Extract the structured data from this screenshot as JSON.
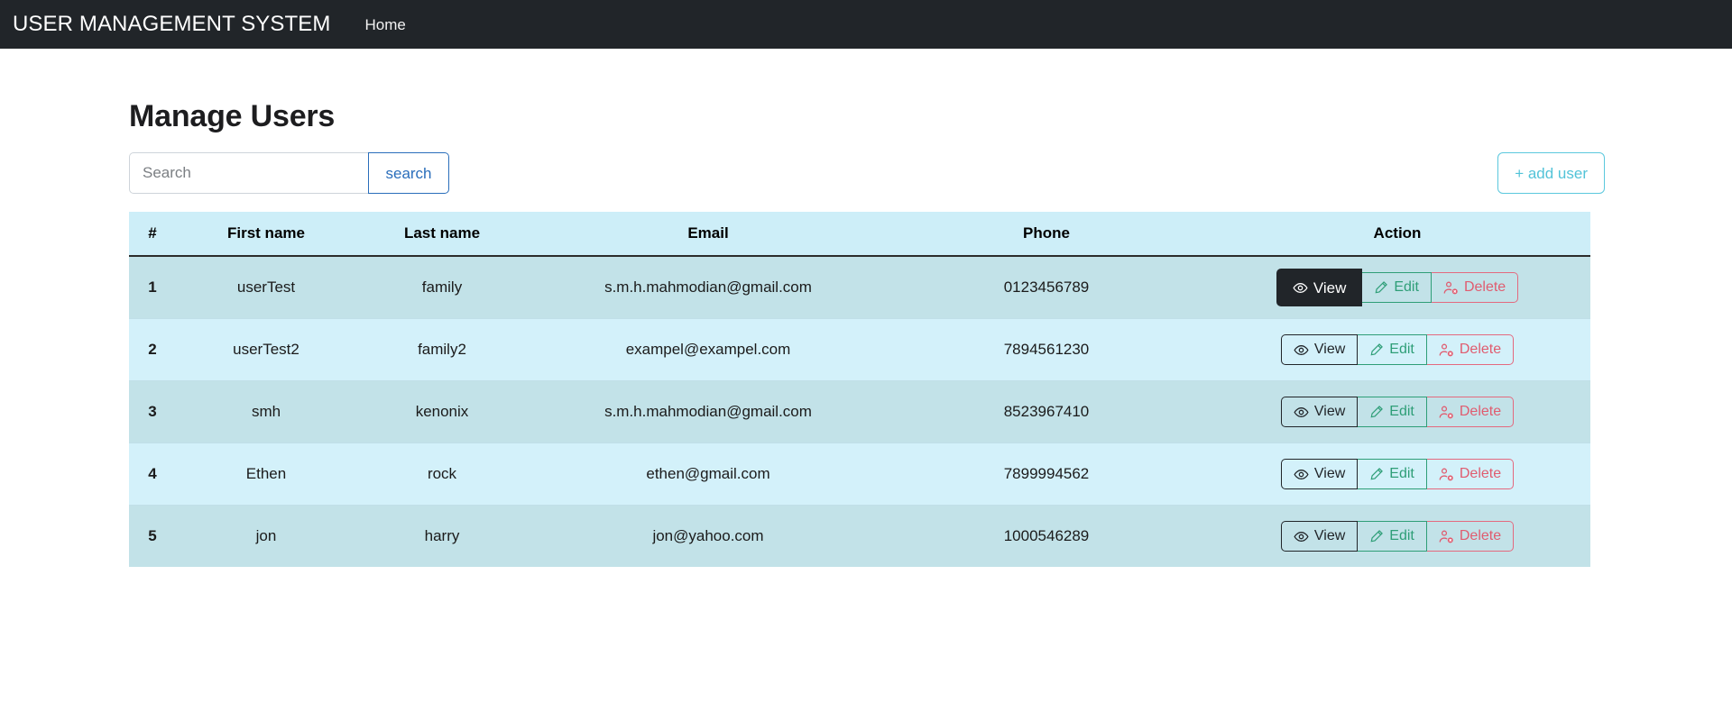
{
  "navbar": {
    "brand": "USER MANAGEMENT SYSTEM",
    "links": [
      {
        "label": "Home",
        "name": "nav-link-home"
      }
    ]
  },
  "page": {
    "title": "Manage Users"
  },
  "search": {
    "value": "",
    "placeholder": "Search",
    "button_label": "search"
  },
  "actions": {
    "add_user_label": "+ add user"
  },
  "table": {
    "columns": [
      {
        "key": "idx",
        "label": "#"
      },
      {
        "key": "first",
        "label": "First name"
      },
      {
        "key": "last",
        "label": "Last name"
      },
      {
        "key": "email",
        "label": "Email"
      },
      {
        "key": "phone",
        "label": "Phone"
      },
      {
        "key": "action",
        "label": "Action"
      }
    ],
    "row_action_labels": {
      "view": "View",
      "edit": "Edit",
      "delete": "Delete"
    },
    "row_action_icons": {
      "view": "eye-icon",
      "edit": "pencil-icon",
      "delete": "user-delete-icon"
    },
    "rows": [
      {
        "idx": "1",
        "first": "userTest",
        "last": "family",
        "email": "s.m.h.mahmodian@gmail.com",
        "phone": "0123456789",
        "view_active": true
      },
      {
        "idx": "2",
        "first": "userTest2",
        "last": "family2",
        "email": "exampel@exampel.com",
        "phone": "7894561230",
        "view_active": false
      },
      {
        "idx": "3",
        "first": "smh",
        "last": "kenonix",
        "email": "s.m.h.mahmodian@gmail.com",
        "phone": "8523967410",
        "view_active": false
      },
      {
        "idx": "4",
        "first": "Ethen",
        "last": "rock",
        "email": "ethen@gmail.com",
        "phone": "7899994562",
        "view_active": false
      },
      {
        "idx": "5",
        "first": "jon",
        "last": "harry",
        "email": "jon@yahoo.com",
        "phone": "1000546289",
        "view_active": false
      }
    ]
  },
  "colors": {
    "navbar_bg": "#212529",
    "header_row_bg": "#cdeef8",
    "row_odd_bg": "#c2e2e8",
    "row_even_bg": "#d3f1fa",
    "search_accent": "#2a6ebb",
    "add_user_accent": "#52c3d8",
    "edit_accent": "#2e9e77",
    "delete_accent": "#e05c6f",
    "view_active_bg": "#212529"
  }
}
